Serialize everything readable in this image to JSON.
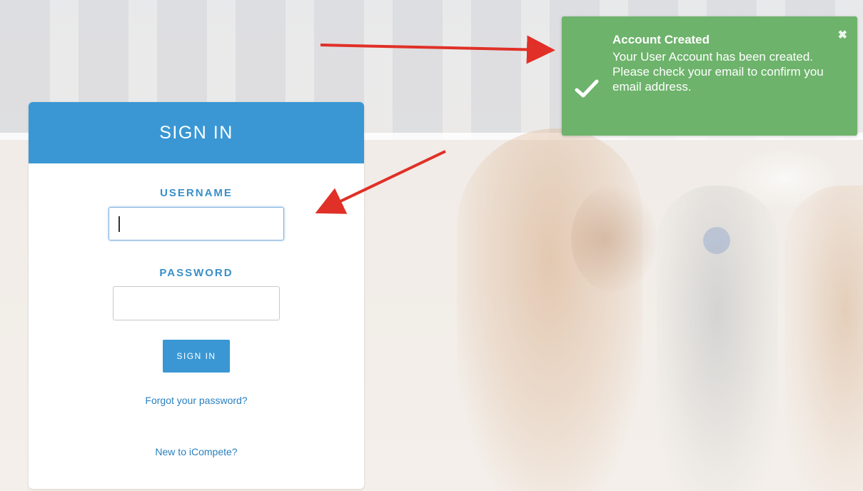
{
  "signin": {
    "title": "SIGN IN",
    "username_label": "USERNAME",
    "username_value": "",
    "password_label": "PASSWORD",
    "password_value": "",
    "button_label": "SIGN IN",
    "forgot_link": "Forgot your password?",
    "new_link": "New to iCompete?"
  },
  "toast": {
    "title": "Account Created",
    "message": "Your User Account has been created. Please check your email to confirm you email address.",
    "close_icon": "close-icon",
    "status_icon": "check-icon"
  },
  "colors": {
    "primary": "#3a97d4",
    "success": "#6db36b",
    "link": "#2a7fbf",
    "annotation": "#e03027"
  }
}
